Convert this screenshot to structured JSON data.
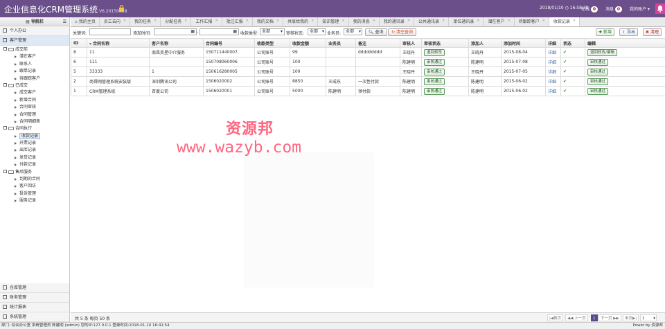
{
  "header": {
    "title": "企业信息化CRM管理系统",
    "version": "V6.20150318",
    "datetime": "2018/01/10 ◷ 16:58:39",
    "online_label": "在线",
    "online_count": "0",
    "msg_label": "消息",
    "msg_count": "0",
    "user_label": "我的账户 ▾"
  },
  "sidebar": {
    "title": "导航栏",
    "top_items": [
      {
        "label": "个人办公"
      },
      {
        "label": "客户管理"
      }
    ],
    "tree": [
      {
        "label": "成交前",
        "type": "folder"
      },
      {
        "label": "潜在客户",
        "type": "leaf"
      },
      {
        "label": "联系人",
        "type": "leaf"
      },
      {
        "label": "跟单记录",
        "type": "leaf"
      },
      {
        "label": "待跟踪客户",
        "type": "leaf"
      },
      {
        "label": "已成交",
        "type": "folder"
      },
      {
        "label": "成交客户",
        "type": "leaf"
      },
      {
        "label": "新增合同",
        "type": "leaf"
      },
      {
        "label": "合同审核",
        "type": "leaf"
      },
      {
        "label": "合同管理",
        "type": "leaf"
      },
      {
        "label": "合同明细表",
        "type": "leaf"
      },
      {
        "label": "合同执行",
        "type": "folder"
      },
      {
        "label": "收款记录",
        "type": "leaf",
        "selected": true
      },
      {
        "label": "开票记录",
        "type": "leaf"
      },
      {
        "label": "出库记录",
        "type": "leaf"
      },
      {
        "label": "发货记录",
        "type": "leaf"
      },
      {
        "label": "付款记录",
        "type": "leaf"
      },
      {
        "label": "售后服务",
        "type": "folder"
      },
      {
        "label": "到期的合同",
        "type": "leaf"
      },
      {
        "label": "客户回访",
        "type": "leaf"
      },
      {
        "label": "投诉管理",
        "type": "leaf"
      },
      {
        "label": "服务记录",
        "type": "leaf"
      }
    ],
    "bottom_items": [
      {
        "label": "仓库管理"
      },
      {
        "label": "财务管理"
      },
      {
        "label": "统计报表"
      },
      {
        "label": "系统管理"
      }
    ]
  },
  "tabs": [
    {
      "label": "我的主页"
    },
    {
      "label": "员工去向"
    },
    {
      "label": "我的任务"
    },
    {
      "label": "分配任务"
    },
    {
      "label": "工作汇报"
    },
    {
      "label": "批注汇报"
    },
    {
      "label": "我的文档"
    },
    {
      "label": "共享给我的"
    },
    {
      "label": "知识管理"
    },
    {
      "label": "我的消息"
    },
    {
      "label": "我的通讯录"
    },
    {
      "label": "公共通讯录"
    },
    {
      "label": "单位通讯录"
    },
    {
      "label": "潜在客户"
    },
    {
      "label": "待跟踪客户"
    },
    {
      "label": "收款记录"
    }
  ],
  "filter": {
    "keyword_label": "关键词:",
    "time_label": "添加时间:",
    "type_label": "收款类型:",
    "type_value": "全部",
    "status_label": "审核状态:",
    "status_value": "全部",
    "staff_label": "业务员:",
    "staff_value": "全部",
    "query": "查询",
    "clear": "清空查询"
  },
  "actions": {
    "add": "新增",
    "export": "导出",
    "clear": "清理"
  },
  "table": {
    "columns": [
      "ID",
      "合同名称",
      "客户名称",
      "合同编号",
      "收款类型",
      "收款金额",
      "业务员",
      "备注",
      "审核人",
      "审核状态",
      "添加人",
      "添加时间",
      "详细",
      "状态",
      "编辑"
    ],
    "rows": [
      {
        "id": "8",
        "contract": "11",
        "customer": "南昌英星中介服务",
        "no": "150711440007",
        "type": "公司账号",
        "amount": "99",
        "staff": "",
        "remark": "ddddddddd",
        "auditor": "王晓丹",
        "audit": "退回修改",
        "adder": "王晓丹",
        "time": "2015-08-04",
        "detail": "详细",
        "edit": "退回修改/编辑"
      },
      {
        "id": "6",
        "contract": "111",
        "customer": "",
        "no": "150708060006",
        "type": "公司账号",
        "amount": "100",
        "staff": "",
        "remark": "",
        "auditor": "陈建明",
        "audit": "审核通过",
        "adder": "陈建明",
        "time": "2015-07-08",
        "detail": "详细",
        "edit": "审核通过"
      },
      {
        "id": "5",
        "contract": "33333",
        "customer": "1",
        "no": "150616280005",
        "type": "公司账号",
        "amount": "100",
        "staff": "",
        "remark": "",
        "auditor": "王晓丹",
        "audit": "审核通过",
        "adder": "王晓丹",
        "time": "2015-07-05",
        "detail": "详细",
        "edit": "审核通过"
      },
      {
        "id": "2",
        "contract": "商得网管理系统安装版",
        "customer": "深圳腾讯公司",
        "no": "1506020002",
        "type": "公司账号",
        "amount": "8850",
        "staff": "王成东",
        "remark": "一次性付款",
        "auditor": "陈建明",
        "audit": "审核通过",
        "adder": "陈建明",
        "time": "2015-06-02",
        "detail": "详细",
        "edit": "审核通过"
      },
      {
        "id": "1",
        "contract": "CRM管理系统",
        "customer": "百度公司",
        "no": "1506020001",
        "type": "公司账号",
        "amount": "5000",
        "staff": "陈建明",
        "remark": "预付款",
        "auditor": "陈建明",
        "audit": "审核通过",
        "adder": "陈建明",
        "time": "2015-06-02",
        "detail": "详细",
        "edit": "审核通过"
      }
    ]
  },
  "watermark": {
    "line1": "资源邦",
    "line2": "www.wazyb.com"
  },
  "pager": {
    "info": "共 5 条 每页 50 条",
    "first": "|◀首页",
    "prev": "◀◀ 上一页",
    "page": "1",
    "next": "下一页 ▶▶",
    "last": "末页▶|",
    "jump": "1"
  },
  "status": {
    "left": "部门: 综合办公室 系统管理员 陈建明 (admin) 您的IP:127.0.0.1 登录时间:2018-01-10 16:41:54",
    "right": "Power by 资源邦"
  },
  "colors": {
    "header": "#6a4f8a",
    "watermark": "#ff4d6a",
    "accent": "#5a4a8a"
  }
}
